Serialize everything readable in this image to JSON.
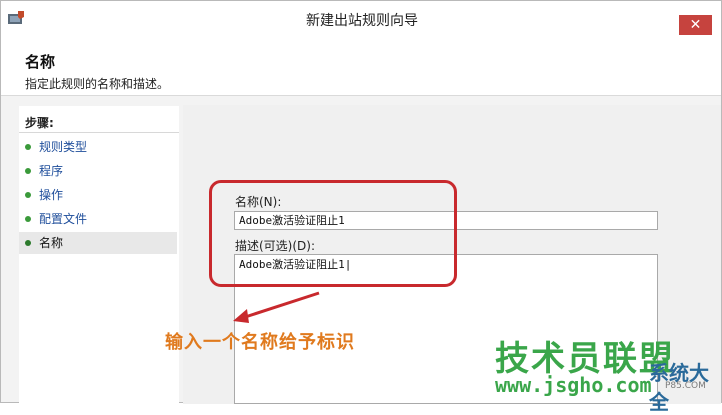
{
  "window": {
    "title": "新建出站规则向导",
    "close_glyph": "✕",
    "icon": "firewall-app-icon"
  },
  "header": {
    "title": "名称",
    "subtitle": "指定此规则的名称和描述。"
  },
  "steps": {
    "heading": "步骤:",
    "items": [
      {
        "label": "规则类型",
        "active": false
      },
      {
        "label": "程序",
        "active": false
      },
      {
        "label": "操作",
        "active": false
      },
      {
        "label": "配置文件",
        "active": false
      },
      {
        "label": "名称",
        "active": true
      }
    ]
  },
  "form": {
    "name_label": "名称(N):",
    "name_value": "Adobe激活验证阻止1",
    "description_label": "描述(可选)(D):",
    "description_value": "Adobe激活验证阻止1|"
  },
  "annotation": {
    "text": "输入一个名称给予标识",
    "color": "#c8292d",
    "text_color": "#e07a1e"
  },
  "watermark": {
    "main": "技术员联盟",
    "url": "www.jsgho.com",
    "side": "系统大全",
    "small": "P85.COM",
    "color": "#3aa64a"
  },
  "colors": {
    "close_button": "#c6433e",
    "step_dot": "#3a9a3a",
    "step_link": "#1f4e9b"
  }
}
